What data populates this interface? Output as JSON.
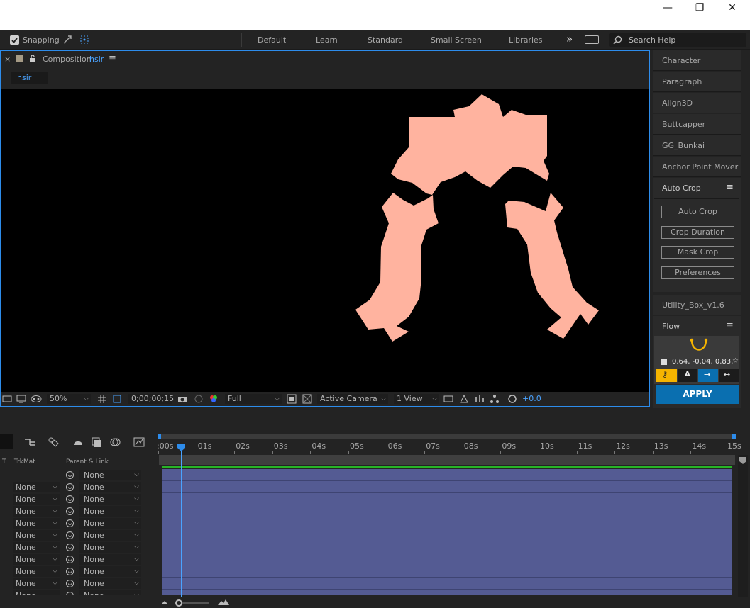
{
  "window": {
    "minimize": "—",
    "maximize": "❐",
    "close": "✕"
  },
  "toolbar": {
    "snapping": "Snapping",
    "workspaces": [
      "Default",
      "Learn",
      "Standard",
      "Small Screen",
      "Libraries"
    ],
    "more": "»",
    "search_placeholder": "Search Help"
  },
  "composition": {
    "close": "×",
    "label": "Composition",
    "name": "hsir",
    "menu": "≡",
    "tab": "hsir"
  },
  "viewer_bar": {
    "zoom": "50%",
    "timecode": "0;00;00;15",
    "resolution": "Full",
    "camera": "Active Camera",
    "views": "1 View",
    "exposure": "+0.0"
  },
  "right_panel": {
    "items_top": [
      "Character",
      "Paragraph",
      "Align3D",
      "Buttcapper",
      "GG_Bunkai",
      "Anchor Point Mover"
    ],
    "auto_crop_title": "Auto Crop",
    "auto_crop_buttons": [
      "Auto Crop",
      "Crop Duration",
      "Mask Crop",
      "Preferences"
    ],
    "utility_box": "Utility_Box_v1.6",
    "flow_title": "Flow",
    "flow_values": "0.64, -0.04, 0.83,",
    "flow_apply": "APPLY",
    "menu": "≡"
  },
  "timeline": {
    "col_t": "T",
    "col_trkmat": ".TrkMat",
    "col_parent": "Parent & Link",
    "ticks": [
      ":00s",
      "01s",
      "02s",
      "03s",
      "04s",
      "05s",
      "06s",
      "07s",
      "08s",
      "09s",
      "10s",
      "11s",
      "12s",
      "13s",
      "14s",
      "15s"
    ],
    "rows": [
      {
        "trkmat": "",
        "parent": "None"
      },
      {
        "trkmat": "None",
        "parent": "None"
      },
      {
        "trkmat": "None",
        "parent": "None"
      },
      {
        "trkmat": "None",
        "parent": "None"
      },
      {
        "trkmat": "None",
        "parent": "None"
      },
      {
        "trkmat": "None",
        "parent": "None"
      },
      {
        "trkmat": "None",
        "parent": "None"
      },
      {
        "trkmat": "None",
        "parent": "None"
      },
      {
        "trkmat": "None",
        "parent": "None"
      },
      {
        "trkmat": "None",
        "parent": "None"
      },
      {
        "trkmat": "None",
        "parent": "None"
      }
    ]
  },
  "colors": {
    "accent": "#2d8ceb",
    "shape": "#ffb39f",
    "layer_bar": "#545b93",
    "apply": "#0a6fb0",
    "flow_active": "#f5b400"
  }
}
